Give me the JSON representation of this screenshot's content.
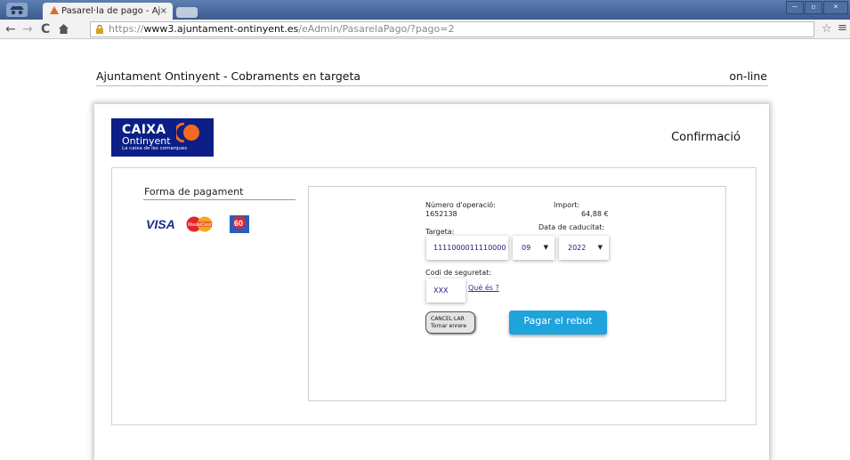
{
  "browser": {
    "tab_title": "Pasarel·la de pago - Aj",
    "tab_close": "×",
    "url_scheme": "https://",
    "url_host": "www3.ajuntament-ontinyent.es",
    "url_path": "/eAdmin/PasarelaPago/?pago=2",
    "win_minimize": "–",
    "win_maximize": "▫",
    "win_close": "×",
    "icons": [
      "incognito-icon",
      "back-icon",
      "forward-icon",
      "reload-icon",
      "home-icon",
      "lock-warning-icon",
      "star-icon",
      "menu-icon"
    ]
  },
  "header": {
    "title": "Ajuntament Ontinyent - Cobraments en targeta",
    "status": "on-line"
  },
  "logo": {
    "line1": "CAIXA",
    "line2": "Ontinyent",
    "line3": "La caixa de les comarques"
  },
  "step_title": "Confirmació",
  "payment_method": {
    "title": "Forma de pagament",
    "brands": [
      "VISA",
      "MasterCard",
      "6000"
    ]
  },
  "form": {
    "operation_label": "Número d'operació:",
    "operation_value": "1652138",
    "amount_label": "Import:",
    "amount_value": "64,88 €",
    "card_label": "Targeta:",
    "card_value": "1111000011110000",
    "expiry_label": "Data de caducitat:",
    "expiry_month": "09",
    "expiry_year": "2022",
    "cvv_label": "Codi de seguretat:",
    "cvv_value": "XXX",
    "cvv_help": "Qué és ?",
    "cancel_line1": "CANCEL·LAR",
    "cancel_line2": "Tornar enrere",
    "pay_label": "Pagar el rebut"
  },
  "colors": {
    "titlebar": "#3b5a8f",
    "logo_bg": "#0b1f86",
    "logo_mark": "#f26a21",
    "pay_button": "#1ea3dc"
  }
}
